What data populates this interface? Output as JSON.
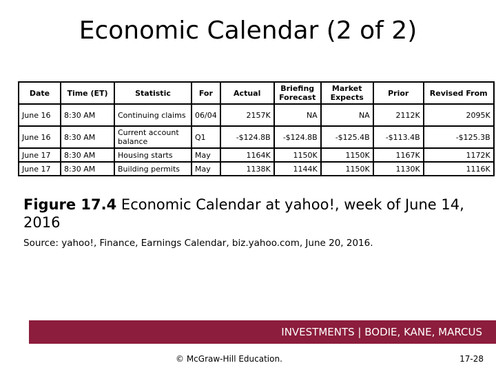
{
  "slide": {
    "title": "Economic Calendar (2 of 2)"
  },
  "table": {
    "headers": [
      "Date",
      "Time (ET)",
      "Statistic",
      "For",
      "Actual",
      "Briefing Forecast",
      "Market Expects",
      "Prior",
      "Revised From"
    ],
    "rows": [
      [
        "June 16",
        "8:30 AM",
        "Continuing claims",
        "06/04",
        "2157K",
        "NA",
        "NA",
        "2112K",
        "2095K"
      ],
      [
        "June 16",
        "8:30 AM",
        "Current account balance",
        "Q1",
        "-$124.8B",
        "-$124.8B",
        "-$125.4B",
        "-$113.4B",
        "-$125.3B"
      ],
      [
        "June 17",
        "8:30 AM",
        "Housing starts",
        "May",
        "1164K",
        "1150K",
        "1150K",
        "1167K",
        "1172K"
      ],
      [
        "June 17",
        "8:30 AM",
        "Building permits",
        "May",
        "1138K",
        "1144K",
        "1150K",
        "1130K",
        "1116K"
      ]
    ]
  },
  "caption": {
    "figure_label": "Figure 17.4",
    "text": " Economic Calendar at yahoo!, week of June 14, 2016",
    "source": "Source: yahoo!, Finance, Earnings Calendar, biz.yahoo.com, June 20, 2016."
  },
  "footer": {
    "banner_text": "INVESTMENTS | BODIE, KANE, MARCUS",
    "banner_color": "#8c1d3c",
    "copyright": "© McGraw-Hill Education.",
    "page_number": "17-28"
  }
}
